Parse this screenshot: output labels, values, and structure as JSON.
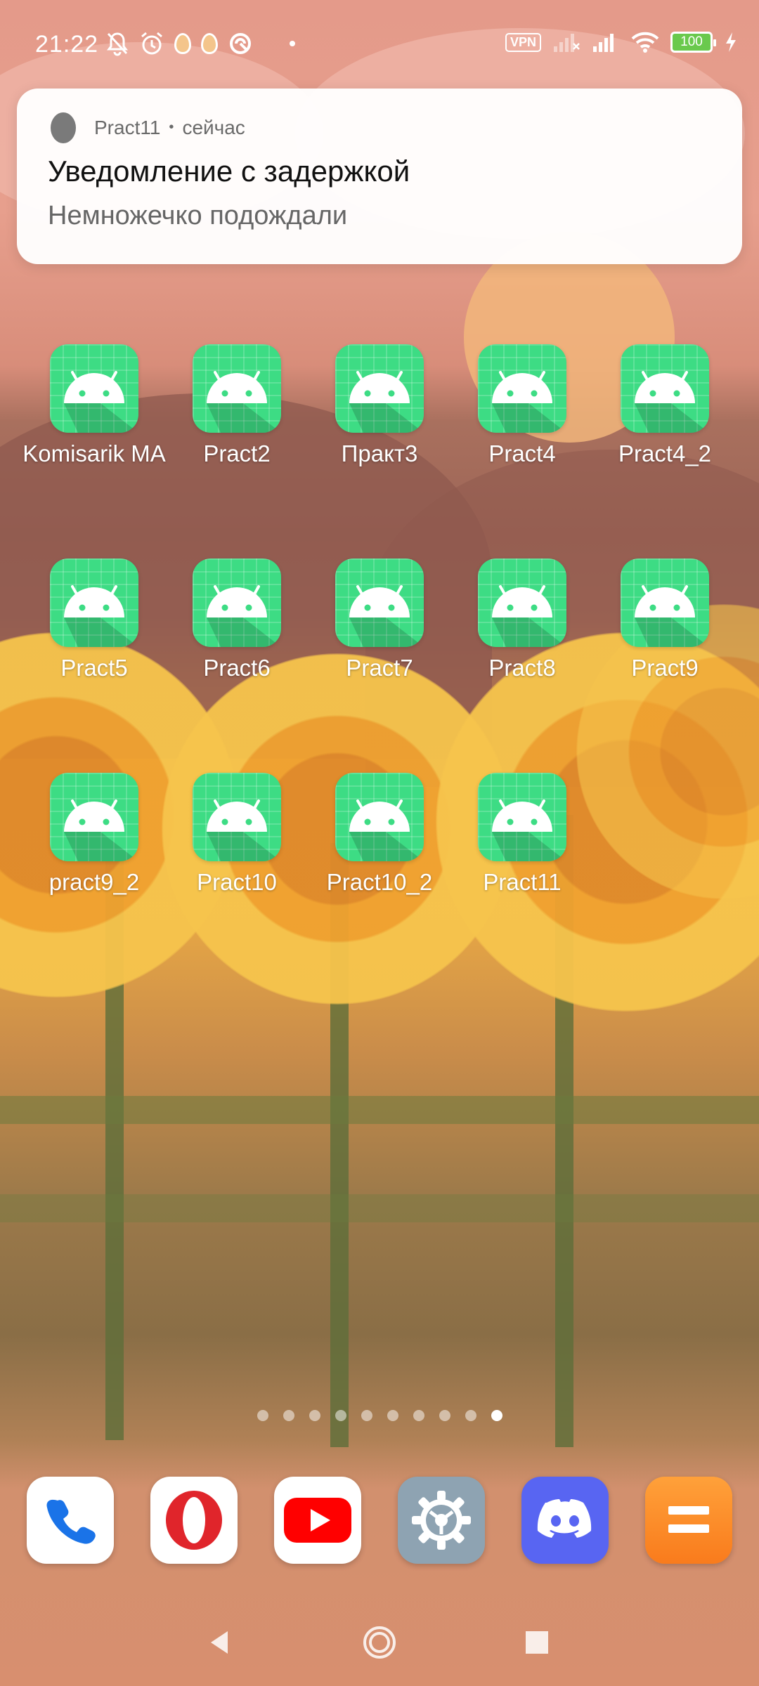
{
  "status_bar": {
    "time": "21:22",
    "left_icons": [
      "bell-off-icon",
      "alarm-icon",
      "egg-icon",
      "egg-icon",
      "vpn-shield-icon",
      "dot-icon"
    ],
    "vpn_label": "VPN",
    "battery_level": "100",
    "right_icons": [
      "vpn-icon",
      "signal-off-icon",
      "signal-icon",
      "wifi-icon",
      "battery-icon",
      "charging-icon"
    ]
  },
  "notification": {
    "app_name": "Pract11",
    "separator": "•",
    "time": "сейчас",
    "title": "Уведомление с задержкой",
    "body": "Немножечко подождали"
  },
  "apps": [
    {
      "label": "Komisarik MA"
    },
    {
      "label": "Pract2"
    },
    {
      "label": "Практ3"
    },
    {
      "label": "Pract4"
    },
    {
      "label": "Pract4_2"
    },
    {
      "label": "Pract5"
    },
    {
      "label": "Pract6"
    },
    {
      "label": "Pract7"
    },
    {
      "label": "Pract8"
    },
    {
      "label": "Pract9"
    },
    {
      "label": "pract9_2"
    },
    {
      "label": "Pract10"
    },
    {
      "label": "Pract10_2"
    },
    {
      "label": "Pract11"
    }
  ],
  "page_indicator": {
    "total": 10,
    "active_index": 9
  },
  "dock": [
    {
      "name": "phone-app",
      "icon": "phone-icon"
    },
    {
      "name": "opera-app",
      "icon": "opera-icon"
    },
    {
      "name": "youtube-app",
      "icon": "youtube-icon"
    },
    {
      "name": "settings-app",
      "icon": "gear-icon"
    },
    {
      "name": "discord-app",
      "icon": "discord-icon"
    },
    {
      "name": "orange-app",
      "icon": "menu-lines-icon"
    }
  ],
  "navigation": {
    "back": "back-icon",
    "home": "home-icon",
    "recents": "recents-icon"
  },
  "colors": {
    "android_green": "#3ddc84",
    "discord": "#5865f2",
    "opera_red": "#e0252b",
    "youtube_red": "#ff0000",
    "battery_green": "#6ac94d"
  }
}
